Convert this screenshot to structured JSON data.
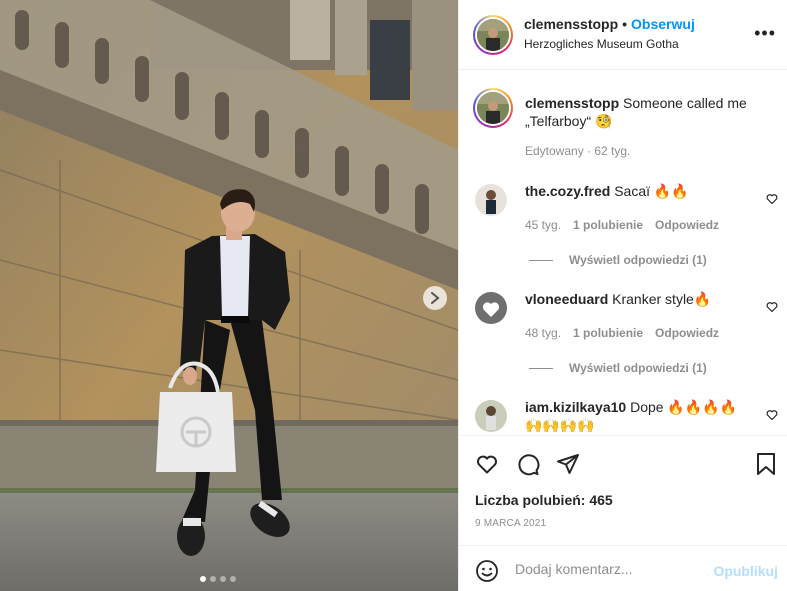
{
  "post": {
    "username": "clemensstopp",
    "separator": "•",
    "follow_label": "Obserwuj",
    "location": "Herzogliches Museum Gotha",
    "more_label": "•••",
    "caption": {
      "username": "clemensstopp",
      "text": "Someone called me „Telfarboy“ 🧐",
      "meta": "Edytowany · 62 tyg."
    },
    "photo_dots": 4,
    "active_dot": 0
  },
  "comments": [
    {
      "username": "the.cozy.fred",
      "text": "Sacaï 🔥🔥",
      "time": "45 tyg.",
      "likes": "1 polubienie",
      "reply": "Odpowiedz",
      "view_replies": "Wyświetl odpowiedzi (1)"
    },
    {
      "username": "vloneeduard",
      "text": "Kranker style🔥",
      "time": "48 tyg.",
      "likes": "1 polubienie",
      "reply": "Odpowiedz",
      "view_replies": "Wyświetl odpowiedzi (1)"
    },
    {
      "username": "iam.kizilkaya10",
      "text": "Dope 🔥🔥🔥🔥 🙌🙌🙌🙌"
    }
  ],
  "footer": {
    "likes_text": "Liczba polubień: 465",
    "date": "9 MARCA 2021",
    "comment_placeholder": "Dodaj komentarz...",
    "publish_label": "Opublikuj"
  },
  "colors": {
    "accent": "#0095f6",
    "publish_disabled": "#b2dffc",
    "muted": "#8e8e8e",
    "border": "#efefef"
  },
  "icons": [
    "chevron-right-icon",
    "more-icon",
    "heart-icon",
    "comment-icon",
    "share-icon",
    "bookmark-icon",
    "emoji-icon"
  ]
}
